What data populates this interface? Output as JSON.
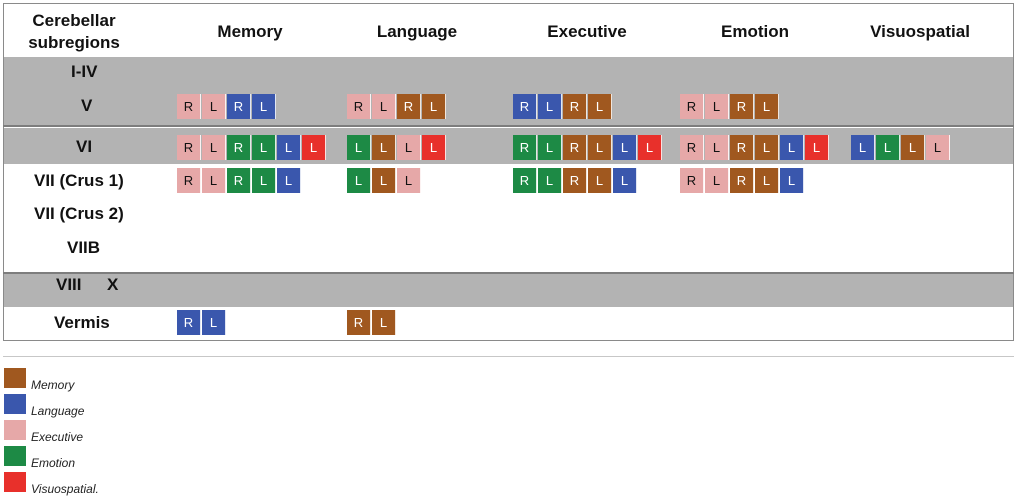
{
  "header": {
    "corner_line1": "Cerebellar",
    "corner_line2": "subregions",
    "columns": [
      "Memory",
      "Language",
      "Executive",
      "Emotion",
      "Visuospatial"
    ]
  },
  "rows": {
    "r1": "I-IV",
    "r2": "V",
    "r3": "VI",
    "r4": "VII (Crus 1)",
    "r5": "VII (Crus 2)",
    "r6": "VIIB",
    "r7a": "VIII",
    "r7b": "X",
    "r8": "Vermis"
  },
  "colors": {
    "memory": "#a0581f",
    "language": "#3a57ad",
    "executive": "#e6a8a8",
    "emotion": "#1d8a45",
    "visuospatial": "#e8302b",
    "band": "#b3b3b3"
  },
  "cells": {
    "V": {
      "Memory": [
        [
          "R",
          "executive"
        ],
        [
          "L",
          "executive"
        ],
        [
          "R",
          "language"
        ],
        [
          "L",
          "language"
        ]
      ],
      "Language": [
        [
          "R",
          "executive"
        ],
        [
          "L",
          "executive"
        ],
        [
          "R",
          "memory"
        ],
        [
          "L",
          "memory"
        ]
      ],
      "Executive": [
        [
          "R",
          "language"
        ],
        [
          "L",
          "language"
        ],
        [
          "R",
          "memory"
        ],
        [
          "L",
          "memory"
        ]
      ],
      "Emotion": [
        [
          "R",
          "executive"
        ],
        [
          "L",
          "executive"
        ],
        [
          "R",
          "memory"
        ],
        [
          "L",
          "memory"
        ]
      ]
    },
    "VI": {
      "Memory": [
        [
          "R",
          "executive"
        ],
        [
          "L",
          "executive"
        ],
        [
          "R",
          "emotion"
        ],
        [
          "L",
          "emotion"
        ],
        [
          "L",
          "language"
        ],
        [
          "L",
          "visuospatial"
        ]
      ],
      "Language": [
        [
          "L",
          "emotion"
        ],
        [
          "L",
          "memory"
        ],
        [
          "L",
          "executive"
        ],
        [
          "L",
          "visuospatial"
        ]
      ],
      "Executive": [
        [
          "R",
          "emotion"
        ],
        [
          "L",
          "emotion"
        ],
        [
          "R",
          "memory"
        ],
        [
          "L",
          "memory"
        ],
        [
          "L",
          "language"
        ],
        [
          "L",
          "visuospatial"
        ]
      ],
      "Emotion": [
        [
          "R",
          "executive"
        ],
        [
          "L",
          "executive"
        ],
        [
          "R",
          "memory"
        ],
        [
          "L",
          "memory"
        ],
        [
          "L",
          "language"
        ],
        [
          "L",
          "visuospatial"
        ]
      ],
      "Visuospatial": [
        [
          "L",
          "language"
        ],
        [
          "L",
          "emotion"
        ],
        [
          "L",
          "memory"
        ],
        [
          "L",
          "executive"
        ]
      ]
    },
    "VII_Crus1": {
      "Memory": [
        [
          "R",
          "executive"
        ],
        [
          "L",
          "executive"
        ],
        [
          "R",
          "emotion"
        ],
        [
          "L",
          "emotion"
        ],
        [
          "L",
          "language"
        ]
      ],
      "Language": [
        [
          "L",
          "emotion"
        ],
        [
          "L",
          "memory"
        ],
        [
          "L",
          "executive"
        ]
      ],
      "Executive": [
        [
          "R",
          "emotion"
        ],
        [
          "L",
          "emotion"
        ],
        [
          "R",
          "memory"
        ],
        [
          "L",
          "memory"
        ],
        [
          "L",
          "language"
        ]
      ],
      "Emotion": [
        [
          "R",
          "executive"
        ],
        [
          "L",
          "executive"
        ],
        [
          "R",
          "memory"
        ],
        [
          "L",
          "memory"
        ],
        [
          "L",
          "language"
        ]
      ]
    },
    "Vermis": {
      "Memory": [
        [
          "R",
          "language"
        ],
        [
          "L",
          "language"
        ]
      ],
      "Language": [
        [
          "R",
          "memory"
        ],
        [
          "L",
          "memory"
        ]
      ]
    }
  },
  "legend": [
    {
      "label": "Memory",
      "color": "memory"
    },
    {
      "label": "Language",
      "color": "language"
    },
    {
      "label": "Executive",
      "color": "executive"
    },
    {
      "label": "Emotion",
      "color": "emotion"
    },
    {
      "label": "Visuospatial.",
      "color": "visuospatial"
    }
  ]
}
